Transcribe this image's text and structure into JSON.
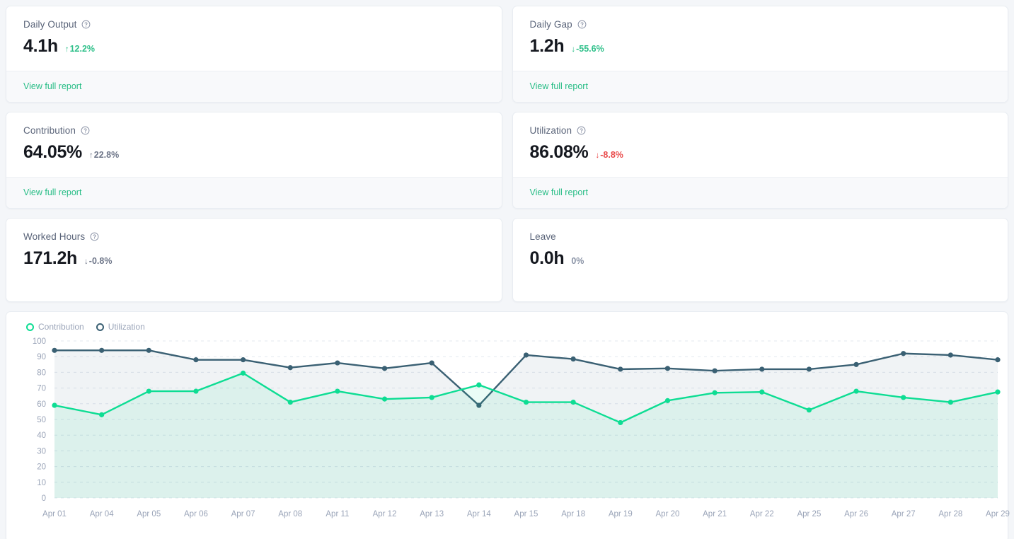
{
  "cards": [
    {
      "title": "Daily Output",
      "has_info_icon": true,
      "info_icon": "help-circle-icon",
      "value": "4.1h",
      "delta_arrow": "↑",
      "delta": "12.2%",
      "delta_color": "#2fc08a",
      "delta_style": "up",
      "footer_link": "View full report",
      "has_footer": true
    },
    {
      "title": "Daily Gap",
      "has_info_icon": true,
      "info_icon": "help-circle-icon",
      "value": "1.2h",
      "delta_arrow": "↓",
      "delta": "-55.6%",
      "delta_color": "#2fc08a",
      "delta_style": "down",
      "footer_link": "View full report",
      "has_footer": true
    },
    {
      "title": "Contribution",
      "has_info_icon": true,
      "info_icon": "help-circle-icon",
      "value": "64.05%",
      "delta_arrow": "↑",
      "delta": "22.8%",
      "delta_color": "#6e7689",
      "delta_style": "muted",
      "footer_link": "View full report",
      "has_footer": true
    },
    {
      "title": "Utilization",
      "has_info_icon": true,
      "info_icon": "help-circle-icon",
      "value": "86.08%",
      "delta_arrow": "↓",
      "delta": "-8.8%",
      "delta_color": "#e94a4a",
      "delta_style": "neg",
      "footer_link": "View full report",
      "has_footer": true
    },
    {
      "title": "Worked Hours",
      "has_info_icon": true,
      "info_icon": "help-circle-icon",
      "value": "171.2h",
      "delta_arrow": "↓",
      "delta": "-0.8%",
      "delta_color": "#6e7689",
      "delta_style": "muted",
      "footer_link": "",
      "has_footer": false
    },
    {
      "title": "Leave",
      "has_info_icon": false,
      "info_icon": "",
      "value": "0.0h",
      "delta_arrow": "",
      "delta": "0%",
      "delta_color": "#8a93a6",
      "delta_style": "flat",
      "footer_link": "",
      "has_footer": false
    }
  ],
  "chart_data": {
    "type": "line",
    "title": "",
    "xlabel": "",
    "ylabel": "",
    "ylim": [
      0,
      100
    ],
    "yticks": [
      0,
      10,
      20,
      30,
      40,
      50,
      60,
      70,
      80,
      90,
      100
    ],
    "grid": true,
    "legend_position": "top-left",
    "area_fill": true,
    "categories": [
      "Apr 01",
      "Apr 04",
      "Apr 05",
      "Apr 06",
      "Apr 07",
      "Apr 08",
      "Apr 11",
      "Apr 12",
      "Apr 13",
      "Apr 14",
      "Apr 15",
      "Apr 18",
      "Apr 19",
      "Apr 20",
      "Apr 21",
      "Apr 22",
      "Apr 25",
      "Apr 26",
      "Apr 27",
      "Apr 28",
      "Apr 29"
    ],
    "series": [
      {
        "name": "Contribution",
        "color": "#0ddd93",
        "values": [
          59,
          53,
          68,
          68,
          79.5,
          61,
          68,
          63,
          64,
          72,
          61,
          61,
          48,
          62,
          67,
          67.5,
          56,
          68,
          64,
          61,
          67.5
        ]
      },
      {
        "name": "Utilization",
        "color": "#3a6073",
        "values": [
          94,
          94,
          94,
          88,
          88,
          83,
          86,
          82.5,
          86,
          59,
          91,
          88.5,
          82,
          82.5,
          81,
          82,
          82,
          85,
          92,
          91,
          88
        ]
      }
    ]
  }
}
